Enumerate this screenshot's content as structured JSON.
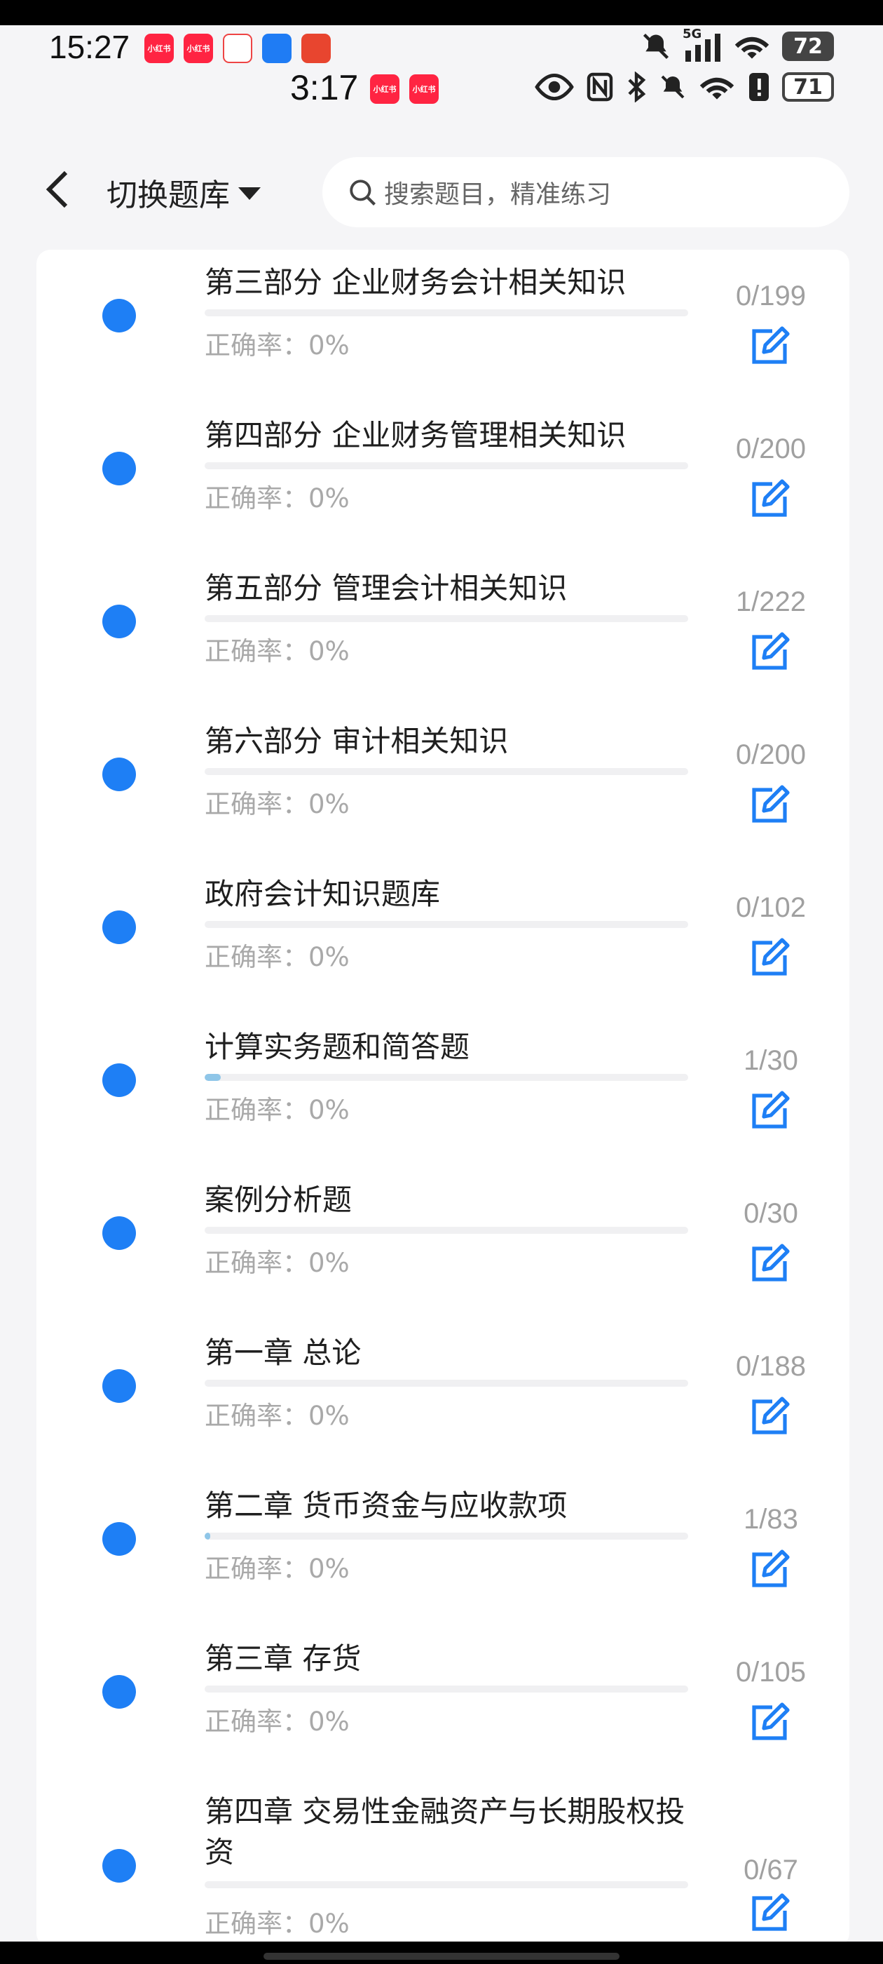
{
  "status_top": {
    "time": "15:27",
    "apps": [
      {
        "label": "小红书",
        "color": "#ff2442"
      },
      {
        "label": "小红书",
        "color": "#ff2442"
      },
      {
        "label": "",
        "color": "#ffffff"
      },
      {
        "label": "",
        "color": "#1f7cf4"
      },
      {
        "label": "",
        "color": "#e8452f"
      }
    ],
    "network": "5G",
    "battery": "72"
  },
  "status_second": {
    "time": "3:17",
    "apps": [
      {
        "label": "小红书",
        "color": "#ff2442"
      },
      {
        "label": "小红书",
        "color": "#ff2442"
      }
    ],
    "battery": "71"
  },
  "navbar": {
    "title": "切换题库",
    "search_placeholder": "搜索题目，精准练习"
  },
  "accuracy_label": "正确率：",
  "colors": {
    "accent": "#1e7ff5",
    "progress": "#8fc6e8"
  },
  "items": [
    {
      "title": "第三部分 企业财务会计相关知识",
      "count": "0/199",
      "progress": 0,
      "accuracy": "0%"
    },
    {
      "title": "第四部分 企业财务管理相关知识",
      "count": "0/200",
      "progress": 0,
      "accuracy": "0%"
    },
    {
      "title": "第五部分 管理会计相关知识",
      "count": "1/222",
      "progress": 0,
      "accuracy": "0%"
    },
    {
      "title": "第六部分 审计相关知识",
      "count": "0/200",
      "progress": 0,
      "accuracy": "0%"
    },
    {
      "title": "政府会计知识题库",
      "count": "0/102",
      "progress": 0,
      "accuracy": "0%"
    },
    {
      "title": "计算实务题和简答题",
      "count": "1/30",
      "progress": 0.033,
      "accuracy": "0%"
    },
    {
      "title": "案例分析题",
      "count": "0/30",
      "progress": 0,
      "accuracy": "0%"
    },
    {
      "title": "第一章 总论",
      "count": "0/188",
      "progress": 0,
      "accuracy": "0%"
    },
    {
      "title": "第二章 货币资金与应收款项",
      "count": "1/83",
      "progress": 0.012,
      "accuracy": "0%"
    },
    {
      "title": "第三章 存货",
      "count": "0/105",
      "progress": 0,
      "accuracy": "0%"
    },
    {
      "title": "第四章 交易性金融资产与长期股权投资",
      "count": "0/67",
      "progress": 0,
      "accuracy": "0%"
    }
  ]
}
